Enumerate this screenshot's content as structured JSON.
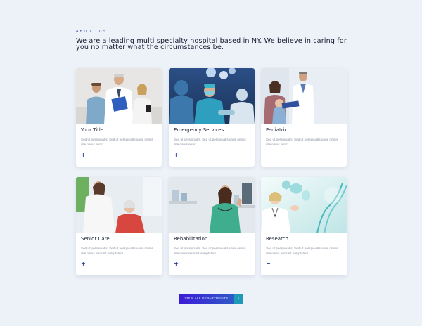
{
  "about": {
    "eyebrow": "ABOUT US",
    "heading": "We are a leading multi specialty hospital based in NY. We believe in caring for you no matter what the circumstances be."
  },
  "cards": [
    {
      "title": "Your Title",
      "text": "Sed ut perspiciatis. Sed ut perspiciatis unde omnis iste natus error.",
      "toggle": "+",
      "image_icon": "doctors-team-photo"
    },
    {
      "title": "Emergency Services",
      "text": "Sed ut perspiciatis. Sed ut perspiciatis unde omnis iste natus error.",
      "toggle": "+",
      "image_icon": "surgery-team-photo"
    },
    {
      "title": "Pediatric",
      "text": "Sed ut perspiciatis. Sed ut perspiciatis unde omnis iste natus error.",
      "toggle": "−",
      "image_icon": "pediatric-family-photo"
    },
    {
      "title": "Senior Care",
      "text": "Sed ut perspiciatis. Sed ut perspiciatis unde omnis iste natus error sit voluptatem.",
      "toggle": "+",
      "image_icon": "senior-care-photo"
    },
    {
      "title": "Rehabilitation",
      "text": "Sed ut perspiciatis. Sed ut perspiciatis unde omnis iste natus error sit voluptatem.",
      "toggle": "+",
      "image_icon": "nurse-thumbs-up-photo"
    },
    {
      "title": "Research",
      "text": "Sed ut perspiciatis. Sed ut perspiciatis unde omnis iste natus error sit voluptatem.",
      "toggle": "−",
      "image_icon": "dna-research-photo"
    }
  ],
  "cta": {
    "label": "VIEW ALL DEPARTMENTS",
    "arrow": "›"
  },
  "colors": {
    "background": "#edf1f8",
    "accent": "#2a3f9a",
    "cta_gradient_start": "#3b1bd8",
    "cta_gradient_end": "#2f5ac9",
    "cta_arrow": "#1e9ab8"
  }
}
